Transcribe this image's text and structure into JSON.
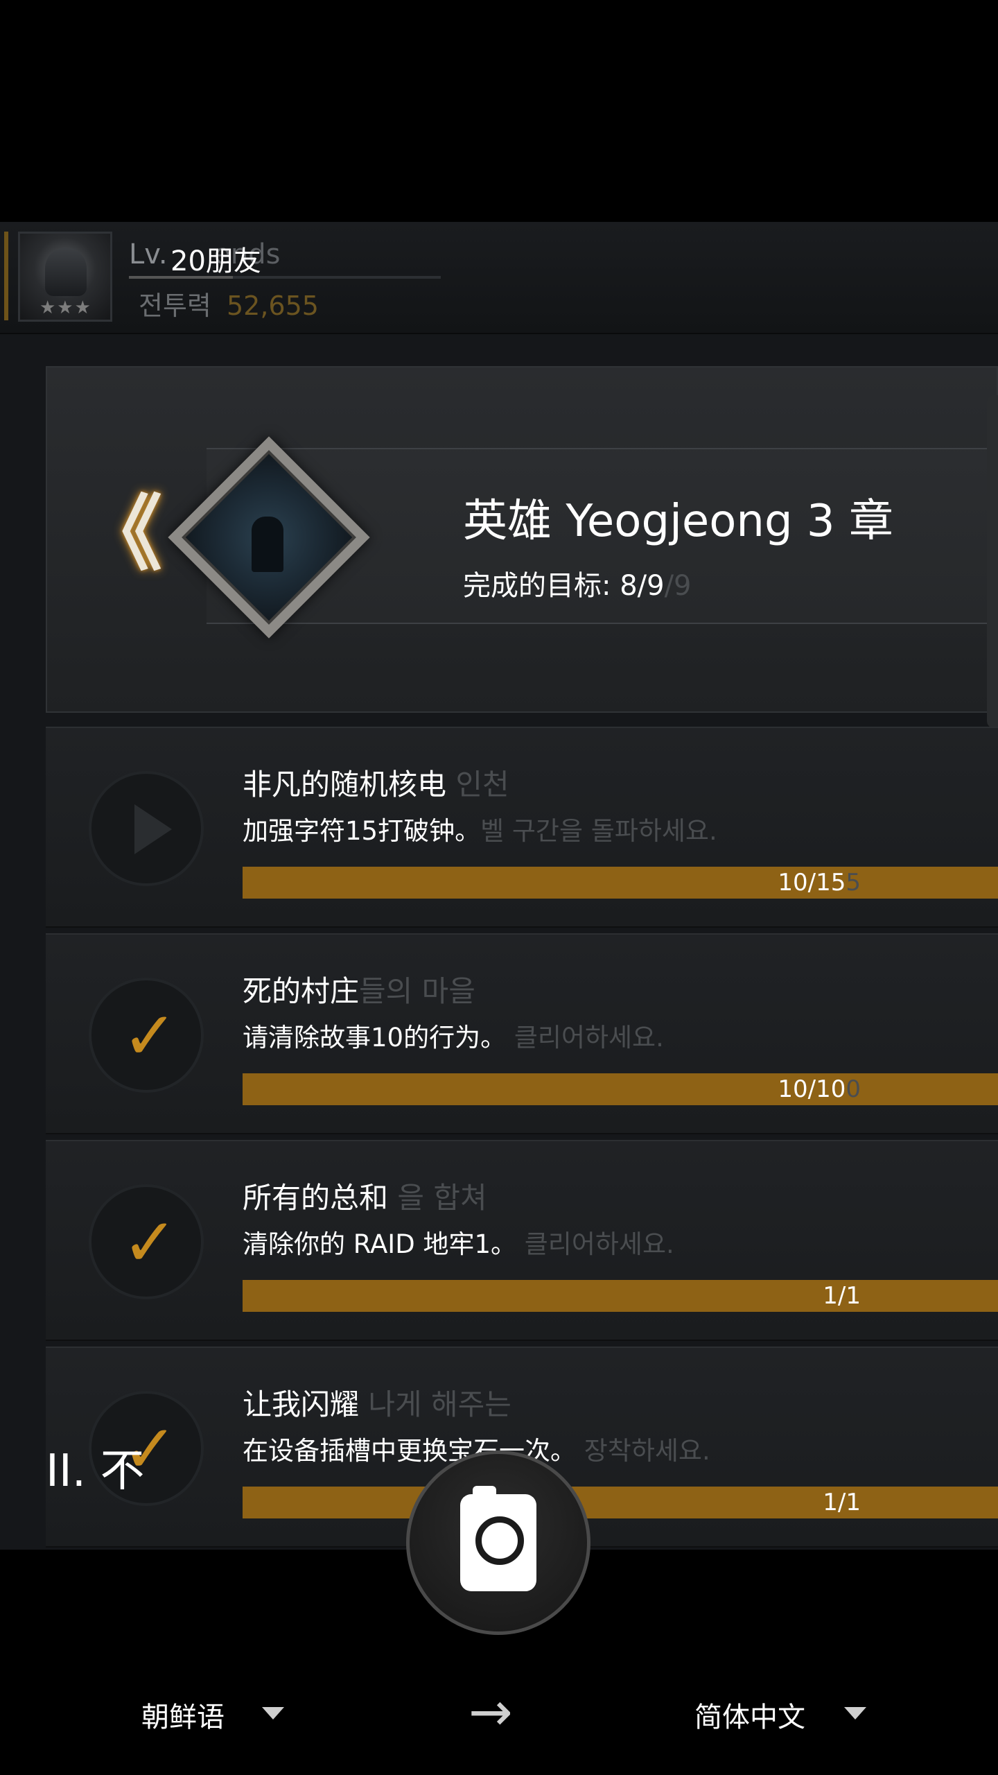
{
  "player": {
    "level_prefix": "Lv.",
    "level_overlay": "20朋友",
    "ghost_name": "ends",
    "power_label": "전투력",
    "power_value": "52,655"
  },
  "chapter": {
    "back_glyph": "《",
    "title": "英雄 Yeogjeong 3 章",
    "goal": "完成的目标: 8/9",
    "goal_ghost": "/9"
  },
  "missions": [
    {
      "state": "active",
      "title": "非凡的随机核电",
      "title_ghost": "인천",
      "desc": "加强字符15打破钟。",
      "desc_ghost": "벨 구간을 돌파하세요.",
      "progress": "10/15",
      "progress_ghost": "5",
      "fraction": 0.667
    },
    {
      "state": "done",
      "title": "死的村庄",
      "title_ghost": "들의 마을",
      "desc": "请清除故事10的行为。",
      "desc_ghost": "클리어하세요.",
      "progress": "10/10",
      "progress_ghost": "0",
      "fraction": 1
    },
    {
      "state": "done",
      "title": "所有的总和",
      "title_ghost": "을 합쳐",
      "desc": "清除你的 RAID 地牢1。",
      "desc_ghost": "클리어하세요.",
      "progress": "1/1",
      "progress_ghost": "",
      "fraction": 1
    },
    {
      "state": "done",
      "title": "让我闪耀",
      "title_ghost": "나게 해주는",
      "desc": "在设备插槽中更换宝石一次。",
      "desc_ghost": "장착하세요.",
      "progress": "1/1",
      "progress_ghost": "",
      "fraction": 1
    }
  ],
  "overlay_text": "II. 不",
  "translator": {
    "source_language": "朝鲜语",
    "target_language": "简体中文",
    "arrow": "→",
    "camera_icon": "camera-icon"
  },
  "colors": {
    "accent_gold": "#9b6b17",
    "check_gold": "#c58a1e",
    "power_gold": "#6b5420"
  }
}
